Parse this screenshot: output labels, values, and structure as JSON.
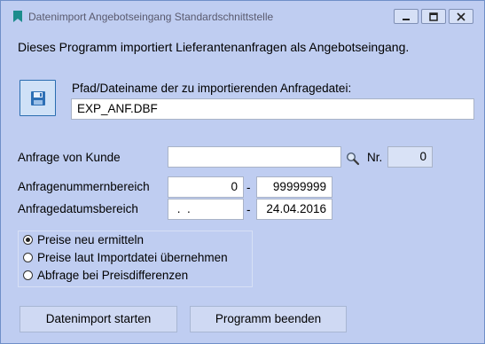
{
  "window": {
    "title": "Datenimport Angebotseingang Standardschnittstelle"
  },
  "intro": "Dieses Programm importiert Lieferantenanfragen als Angebotseingang.",
  "file": {
    "label": "Pfad/Dateiname der zu importierenden Anfragedatei:",
    "value": "EXP_ANF.DBF"
  },
  "kunde": {
    "label": "Anfrage von Kunde",
    "value": "",
    "nr_label": "Nr.",
    "nr_value": "0"
  },
  "nummernbereich": {
    "label": "Anfragenummernbereich",
    "from": "0",
    "separator": "-",
    "to": "99999999"
  },
  "datumsbereich": {
    "label": "Anfragedatumsbereich",
    "from": " .  .",
    "separator": "-",
    "to": "24.04.2016"
  },
  "options": [
    {
      "label": "Preise neu ermitteln",
      "checked": true
    },
    {
      "label": "Preise laut Importdatei übernehmen",
      "checked": false
    },
    {
      "label": "Abfrage bei Preisdifferenzen",
      "checked": false
    }
  ],
  "buttons": {
    "start": "Datenimport starten",
    "end": "Programm beenden"
  },
  "icons": {
    "app": "bookmark-icon",
    "save": "floppy-disk-icon",
    "search": "magnifier-icon"
  }
}
